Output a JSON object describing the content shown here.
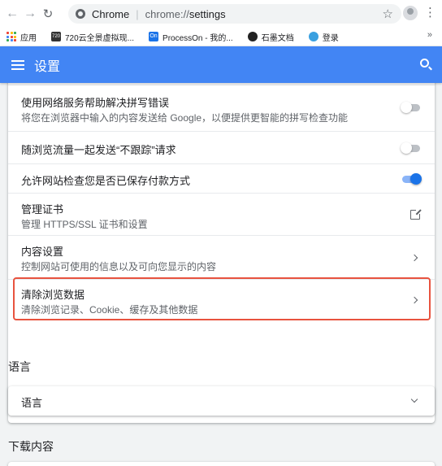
{
  "browser": {
    "site_name": "Chrome",
    "url_prefix": "chrome://",
    "url_page": "settings"
  },
  "bookmarks": [
    {
      "label": "应用"
    },
    {
      "label": "720云全景虚拟现..."
    },
    {
      "label": "ProcessOn - 我的..."
    },
    {
      "label": "石墨文档"
    },
    {
      "label": "登录"
    }
  ],
  "bookmarks_more": "»",
  "header": {
    "title": "设置"
  },
  "rows": [
    {
      "label": "使用网络服务帮助解决拼写错误",
      "sub": "将您在浏览器中输入的内容发送给 Google，以便提供更智能的拼写检查功能",
      "control": "toggle",
      "state": "off"
    },
    {
      "label": "随浏览流量一起发送“不跟踪”请求",
      "control": "toggle",
      "state": "off"
    },
    {
      "label": "允许网站检查您是否已保存付款方式",
      "control": "toggle",
      "state": "on"
    },
    {
      "label": "管理证书",
      "sub": "管理 HTTPS/SSL 证书和设置",
      "control": "external-link"
    },
    {
      "label": "内容设置",
      "sub": "控制网站可使用的信息以及可向您显示的内容",
      "control": "arrow"
    },
    {
      "label": "清除浏览数据",
      "sub": "清除浏览记录、Cookie、缓存及其他数据",
      "control": "arrow"
    }
  ],
  "language_section": {
    "title": "语言",
    "item": "语言"
  },
  "downloads_section": {
    "title": "下载内容"
  },
  "colors": {
    "header_bg": "#4285f4",
    "toggle_on": "#1a73e8",
    "highlight_border": "#e8533f"
  }
}
